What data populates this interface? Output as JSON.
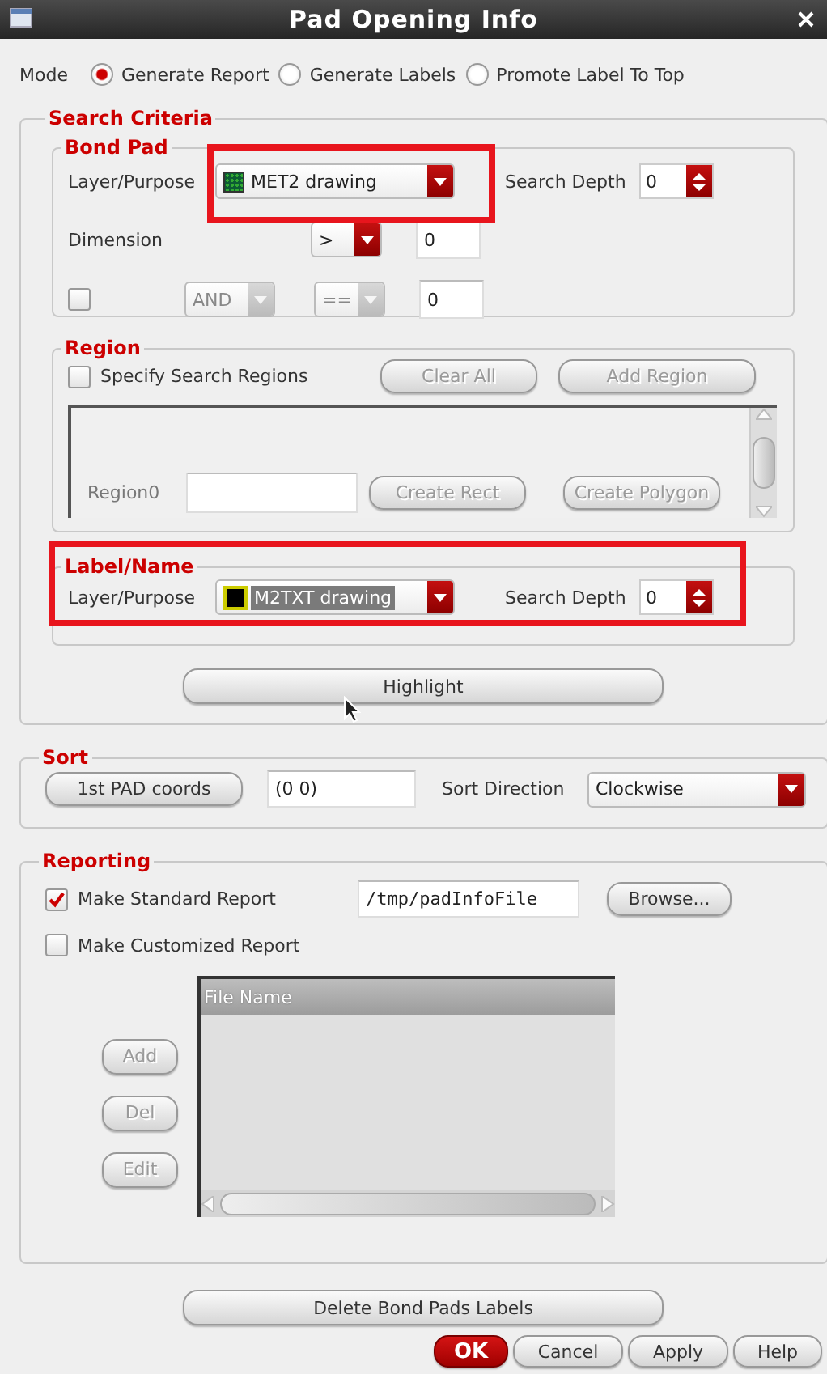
{
  "window": {
    "title": "Pad Opening Info"
  },
  "mode": {
    "label": "Mode",
    "options": [
      {
        "label": "Generate Report",
        "selected": true
      },
      {
        "label": "Generate Labels",
        "selected": false
      },
      {
        "label": "Promote Label To Top",
        "selected": false
      }
    ]
  },
  "search_criteria": {
    "title": "Search Criteria",
    "bond_pad": {
      "title": "Bond Pad",
      "layer_label": "Layer/Purpose",
      "layer": {
        "value": "MET2 drawing",
        "color": "#0d5c34",
        "highlighted": false
      },
      "depth_label": "Search Depth",
      "depth": "0",
      "dimension_label": "Dimension",
      "dimension_operator": ">",
      "dimension_value": "0",
      "condition": {
        "checked": false,
        "logic": "AND",
        "operator": "==",
        "value": "0"
      }
    },
    "region": {
      "title": "Region",
      "specify": {
        "label": "Specify Search Regions",
        "checked": false
      },
      "buttons": [
        {
          "label": "Clear All",
          "disabled": true
        },
        {
          "label": "Add Region",
          "disabled": true
        }
      ],
      "region_label": "Region0",
      "create_buttons": [
        {
          "label": "Create Rect",
          "disabled": true
        },
        {
          "label": "Create Polygon",
          "disabled": true
        }
      ]
    },
    "label_name": {
      "title": "Label/Name",
      "layer_label": "Layer/Purpose",
      "layer": {
        "value": "M2TXT drawing",
        "color": "#000000",
        "highlighted": true
      },
      "depth_label": "Search Depth",
      "depth": "0"
    },
    "highlight_button": "Highlight"
  },
  "sort": {
    "title": "Sort",
    "coords_button": "1st PAD coords",
    "coords": "(0  0)",
    "direction_label": "Sort Direction",
    "direction": "Clockwise"
  },
  "reporting": {
    "title": "Reporting",
    "standard": {
      "label": "Make Standard Report",
      "checked": true,
      "file": "/tmp/padInfoFile",
      "browse": "Browse..."
    },
    "customized": {
      "label": "Make Customized Report",
      "checked": false
    },
    "table": {
      "columns": [
        "File Name"
      ]
    },
    "buttons": [
      {
        "label": "Add",
        "disabled": true
      },
      {
        "label": "Del",
        "disabled": true
      },
      {
        "label": "Edit",
        "disabled": true
      }
    ]
  },
  "delete_button": "Delete Bond Pads Labels",
  "footer_buttons": [
    {
      "label": "OK",
      "kind": "default"
    },
    {
      "label": "Cancel",
      "kind": "normal"
    },
    {
      "label": "Apply",
      "kind": "normal"
    },
    {
      "label": "Help",
      "kind": "normal"
    }
  ]
}
